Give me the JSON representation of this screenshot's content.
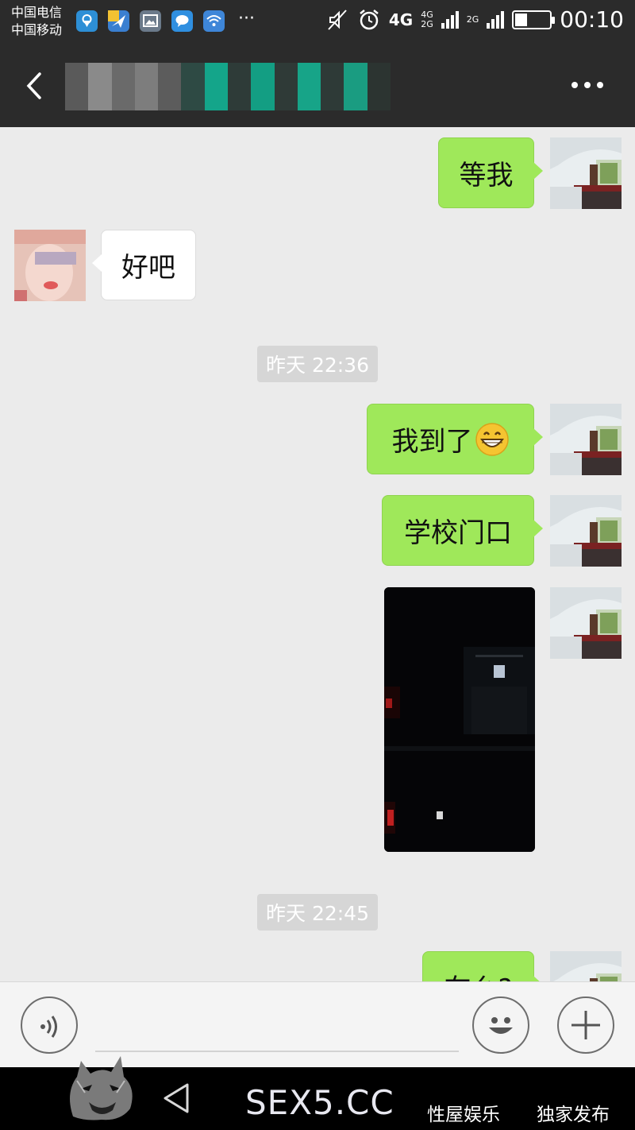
{
  "status_bar": {
    "carrier_1": "中国电信",
    "carrier_2": "中国移动",
    "more_notifications": "···",
    "network_4g": "4G",
    "network_4g_small": "4G",
    "network_2g_small": "2G",
    "network_2g": "2G",
    "battery_level": 0.35,
    "time": "00:10"
  },
  "title_bar": {
    "back_icon": "chevron-left-icon",
    "more_icon": "more-dots-icon"
  },
  "messages": [
    {
      "side": "me",
      "text": "等我"
    },
    {
      "side": "other",
      "text": "好吧"
    },
    {
      "type": "timestamp",
      "text": "昨天 22:36"
    },
    {
      "side": "me",
      "text": "我到了",
      "emoji": "grinning-face-icon"
    },
    {
      "side": "me",
      "text": "学校门口"
    },
    {
      "side": "me",
      "type": "image"
    },
    {
      "type": "timestamp",
      "text": "昨天 22:45"
    },
    {
      "side": "me",
      "text": "在么?"
    }
  ],
  "input_bar": {
    "voice_icon": "voice-icon",
    "emoji_icon": "emoji-icon",
    "plus_icon": "plus-icon"
  },
  "watermark": {
    "main": "SEX5.CC",
    "tag_1": "性屋娱乐",
    "tag_2": "独家发布"
  },
  "colors": {
    "bar_bg": "#2b2b2b",
    "chat_bg": "#ebebeb",
    "my_bubble": "#9fe85a",
    "other_bubble": "#ffffff",
    "timestamp_bg": "#d6d6d6"
  }
}
